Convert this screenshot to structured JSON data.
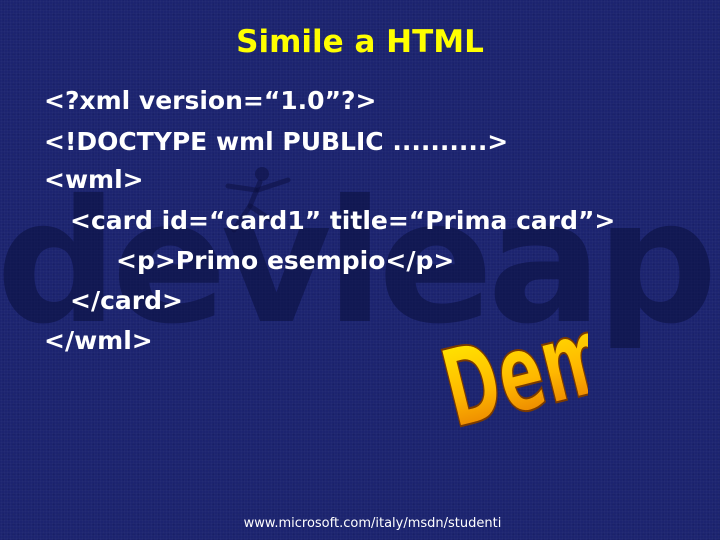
{
  "slide": {
    "title": "Simile a HTML",
    "code_lines": [
      "<?xml version=“1.0”?>",
      "<!DOCTYPE wml PUBLIC ..........>",
      "<wml>",
      "<card id=“card1” title=“Prima card”>",
      "<p>Primo esempio</p>",
      "</card>",
      "</wml>"
    ],
    "demo_logo_text": "Demo",
    "watermark_text": "devleap",
    "footer_url": "www.microsoft.com/italy/msdn/studenti"
  },
  "colors": {
    "background": "#1c2470",
    "title": "#ffff00",
    "code_text": "#ffffff",
    "demo_gradient_top": "#fff200",
    "demo_gradient_bottom": "#e06a00"
  },
  "icons": {
    "watermark_figure": "leaping-figure-icon",
    "demo_logo": "demo-logo-icon"
  }
}
